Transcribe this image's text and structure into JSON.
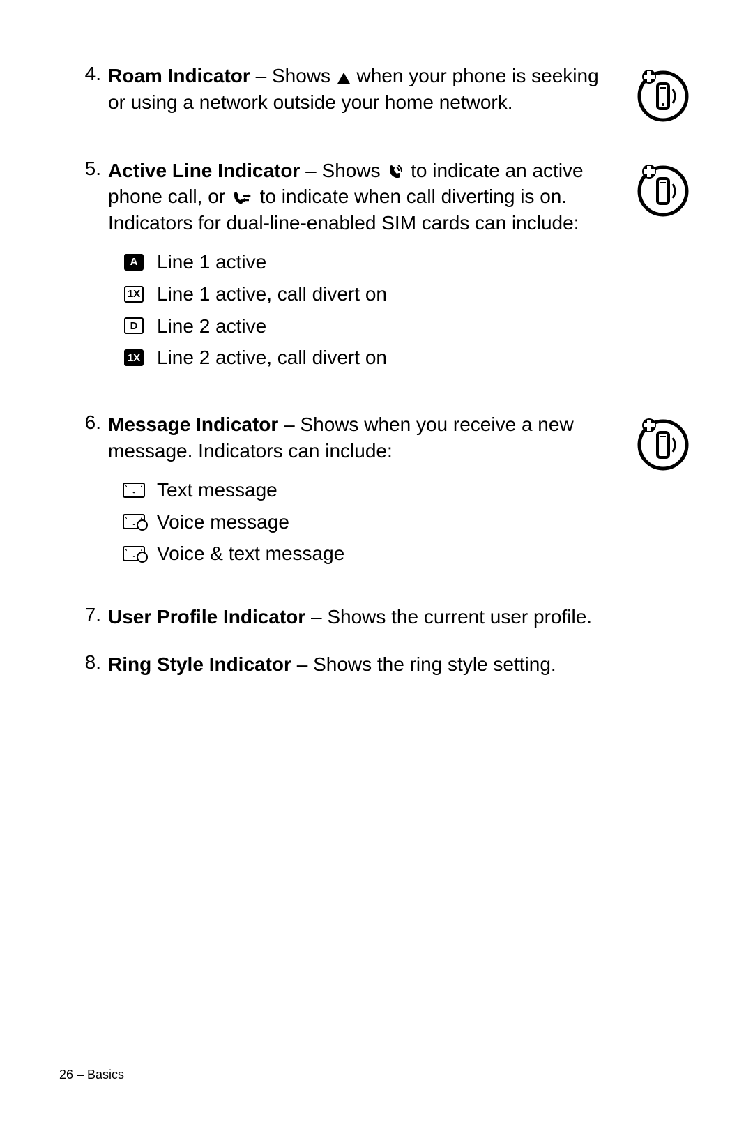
{
  "items": {
    "4": {
      "num": "4.",
      "title": "Roam Indicator",
      "text_before": " – Shows ",
      "text_after": " when your phone is seeking or using a network outside your home network."
    },
    "5": {
      "num": "5.",
      "title": "Active Line Indicator",
      "text1": " – Shows ",
      "text2": " to indicate an active phone call, or ",
      "text3": " to indicate when call diverting is on. Indicators for dual-line-enabled SIM cards can include:",
      "sub": {
        "a": {
          "icon": "A",
          "label": "Line 1 active"
        },
        "b": {
          "icon": "1X",
          "label": "Line 1 active, call divert on"
        },
        "c": {
          "icon": "D",
          "label": "Line 2 active"
        },
        "d": {
          "icon": "1X",
          "label": "Line 2 active, call divert on"
        }
      }
    },
    "6": {
      "num": "6.",
      "title": "Message Indicator",
      "text": " – Shows when you receive a new message. Indicators can include:",
      "sub": {
        "a": {
          "label": "Text message"
        },
        "b": {
          "label": "Voice message"
        },
        "c": {
          "label": "Voice & text message"
        }
      }
    },
    "7": {
      "num": "7.",
      "title": "User Profile Indicator",
      "text": " – Shows the current user profile."
    },
    "8": {
      "num": "8.",
      "title": "Ring Style Indicator",
      "text": " – Shows the ring style setting."
    }
  },
  "footer": "26 – Basics"
}
